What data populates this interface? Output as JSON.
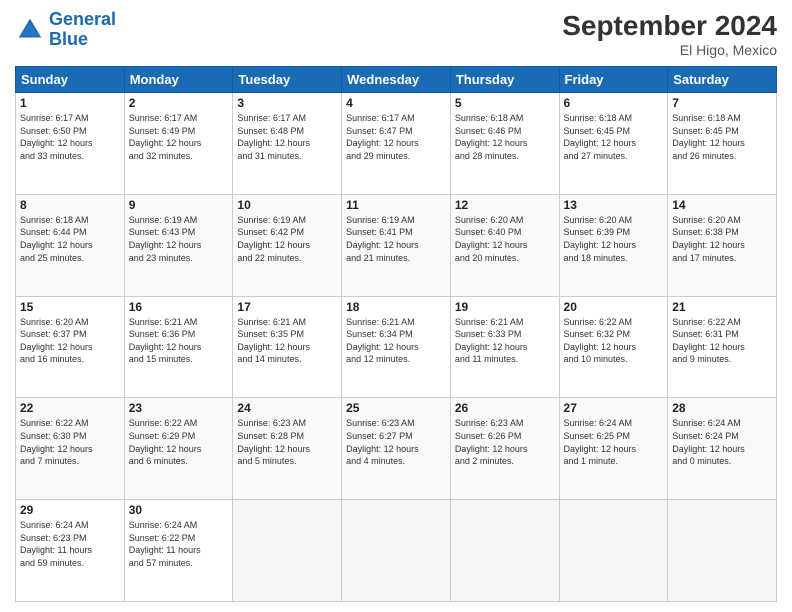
{
  "header": {
    "logo_general": "General",
    "logo_blue": "Blue",
    "month_year": "September 2024",
    "location": "El Higo, Mexico"
  },
  "days_of_week": [
    "Sunday",
    "Monday",
    "Tuesday",
    "Wednesday",
    "Thursday",
    "Friday",
    "Saturday"
  ],
  "weeks": [
    [
      {
        "day": "1",
        "info": "Sunrise: 6:17 AM\nSunset: 6:50 PM\nDaylight: 12 hours\nand 33 minutes."
      },
      {
        "day": "2",
        "info": "Sunrise: 6:17 AM\nSunset: 6:49 PM\nDaylight: 12 hours\nand 32 minutes."
      },
      {
        "day": "3",
        "info": "Sunrise: 6:17 AM\nSunset: 6:48 PM\nDaylight: 12 hours\nand 31 minutes."
      },
      {
        "day": "4",
        "info": "Sunrise: 6:17 AM\nSunset: 6:47 PM\nDaylight: 12 hours\nand 29 minutes."
      },
      {
        "day": "5",
        "info": "Sunrise: 6:18 AM\nSunset: 6:46 PM\nDaylight: 12 hours\nand 28 minutes."
      },
      {
        "day": "6",
        "info": "Sunrise: 6:18 AM\nSunset: 6:45 PM\nDaylight: 12 hours\nand 27 minutes."
      },
      {
        "day": "7",
        "info": "Sunrise: 6:18 AM\nSunset: 6:45 PM\nDaylight: 12 hours\nand 26 minutes."
      }
    ],
    [
      {
        "day": "8",
        "info": "Sunrise: 6:18 AM\nSunset: 6:44 PM\nDaylight: 12 hours\nand 25 minutes."
      },
      {
        "day": "9",
        "info": "Sunrise: 6:19 AM\nSunset: 6:43 PM\nDaylight: 12 hours\nand 23 minutes."
      },
      {
        "day": "10",
        "info": "Sunrise: 6:19 AM\nSunset: 6:42 PM\nDaylight: 12 hours\nand 22 minutes."
      },
      {
        "day": "11",
        "info": "Sunrise: 6:19 AM\nSunset: 6:41 PM\nDaylight: 12 hours\nand 21 minutes."
      },
      {
        "day": "12",
        "info": "Sunrise: 6:20 AM\nSunset: 6:40 PM\nDaylight: 12 hours\nand 20 minutes."
      },
      {
        "day": "13",
        "info": "Sunrise: 6:20 AM\nSunset: 6:39 PM\nDaylight: 12 hours\nand 18 minutes."
      },
      {
        "day": "14",
        "info": "Sunrise: 6:20 AM\nSunset: 6:38 PM\nDaylight: 12 hours\nand 17 minutes."
      }
    ],
    [
      {
        "day": "15",
        "info": "Sunrise: 6:20 AM\nSunset: 6:37 PM\nDaylight: 12 hours\nand 16 minutes."
      },
      {
        "day": "16",
        "info": "Sunrise: 6:21 AM\nSunset: 6:36 PM\nDaylight: 12 hours\nand 15 minutes."
      },
      {
        "day": "17",
        "info": "Sunrise: 6:21 AM\nSunset: 6:35 PM\nDaylight: 12 hours\nand 14 minutes."
      },
      {
        "day": "18",
        "info": "Sunrise: 6:21 AM\nSunset: 6:34 PM\nDaylight: 12 hours\nand 12 minutes."
      },
      {
        "day": "19",
        "info": "Sunrise: 6:21 AM\nSunset: 6:33 PM\nDaylight: 12 hours\nand 11 minutes."
      },
      {
        "day": "20",
        "info": "Sunrise: 6:22 AM\nSunset: 6:32 PM\nDaylight: 12 hours\nand 10 minutes."
      },
      {
        "day": "21",
        "info": "Sunrise: 6:22 AM\nSunset: 6:31 PM\nDaylight: 12 hours\nand 9 minutes."
      }
    ],
    [
      {
        "day": "22",
        "info": "Sunrise: 6:22 AM\nSunset: 6:30 PM\nDaylight: 12 hours\nand 7 minutes."
      },
      {
        "day": "23",
        "info": "Sunrise: 6:22 AM\nSunset: 6:29 PM\nDaylight: 12 hours\nand 6 minutes."
      },
      {
        "day": "24",
        "info": "Sunrise: 6:23 AM\nSunset: 6:28 PM\nDaylight: 12 hours\nand 5 minutes."
      },
      {
        "day": "25",
        "info": "Sunrise: 6:23 AM\nSunset: 6:27 PM\nDaylight: 12 hours\nand 4 minutes."
      },
      {
        "day": "26",
        "info": "Sunrise: 6:23 AM\nSunset: 6:26 PM\nDaylight: 12 hours\nand 2 minutes."
      },
      {
        "day": "27",
        "info": "Sunrise: 6:24 AM\nSunset: 6:25 PM\nDaylight: 12 hours\nand 1 minute."
      },
      {
        "day": "28",
        "info": "Sunrise: 6:24 AM\nSunset: 6:24 PM\nDaylight: 12 hours\nand 0 minutes."
      }
    ],
    [
      {
        "day": "29",
        "info": "Sunrise: 6:24 AM\nSunset: 6:23 PM\nDaylight: 11 hours\nand 59 minutes."
      },
      {
        "day": "30",
        "info": "Sunrise: 6:24 AM\nSunset: 6:22 PM\nDaylight: 11 hours\nand 57 minutes."
      },
      {
        "day": "",
        "info": ""
      },
      {
        "day": "",
        "info": ""
      },
      {
        "day": "",
        "info": ""
      },
      {
        "day": "",
        "info": ""
      },
      {
        "day": "",
        "info": ""
      }
    ]
  ]
}
